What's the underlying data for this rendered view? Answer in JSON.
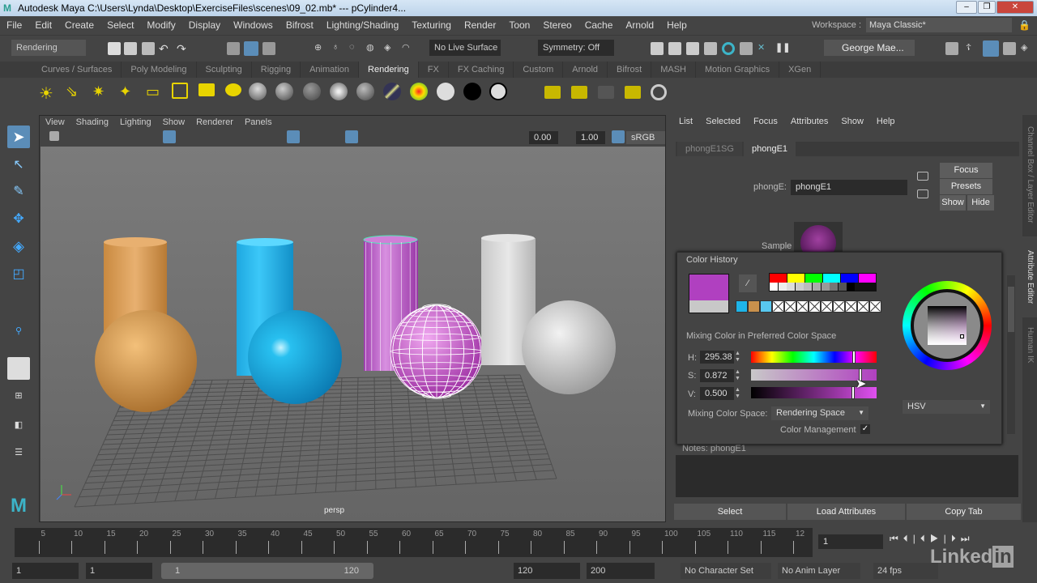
{
  "title": "Autodesk Maya  C:\\Users\\Lynda\\Desktop\\ExerciseFiles\\scenes\\09_02.mb*   ---   pCylinder4...",
  "menu": [
    "File",
    "Edit",
    "Create",
    "Select",
    "Modify",
    "Display",
    "Windows",
    "Bifrost",
    "Lighting/Shading",
    "Texturing",
    "Render",
    "Toon",
    "Stereo",
    "Cache",
    "Arnold",
    "Help"
  ],
  "workspace": {
    "label": "Workspace :",
    "value": "Maya Classic*"
  },
  "status": {
    "menuset": "Rendering",
    "live_surface": "No Live Surface",
    "symmetry": "Symmetry: Off",
    "user": "George Mae..."
  },
  "shelf_tabs": [
    "Curves / Surfaces",
    "Poly Modeling",
    "Sculpting",
    "Rigging",
    "Animation",
    "Rendering",
    "FX",
    "FX Caching",
    "Custom",
    "Arnold",
    "Bifrost",
    "MASH",
    "Motion Graphics",
    "XGen"
  ],
  "viewport": {
    "menu": [
      "View",
      "Shading",
      "Lighting",
      "Show",
      "Renderer",
      "Panels"
    ],
    "exposure": "0.00",
    "gamma": "1.00",
    "colorspace": "sRGB gam",
    "camera": "persp"
  },
  "ae": {
    "menu": [
      "List",
      "Selected",
      "Focus",
      "Attributes",
      "Show",
      "Help"
    ],
    "tabs": [
      "phongE1SG",
      "phongE1"
    ],
    "node_label": "phongE:",
    "node_value": "phongE1",
    "focus": "Focus",
    "presets": "Presets",
    "show": "Show",
    "hide": "Hide",
    "sample": "Sample",
    "notes": "Notes:  phongE1",
    "select": "Select",
    "load": "Load Attributes",
    "copy": "Copy Tab"
  },
  "side_tabs": [
    "Channel Box / Layer Editor",
    "Attribute Editor",
    "Human IK"
  ],
  "color_picker": {
    "history_label": "Color History",
    "mixing_label": "Mixing Color in Preferred Color Space",
    "h_label": "H:",
    "h": "295.38",
    "s_label": "S:",
    "s": "0.872",
    "v_label": "V:",
    "v": "0.500",
    "space_label": "Mixing Color Space:",
    "space": "Rendering Space",
    "mgmt": "Color Management",
    "mode": "HSV",
    "current_color": "#b040c0",
    "previous_color": "#c8c8c8",
    "h_fraction": 0.82,
    "s_fraction": 0.872,
    "v_fraction": 0.5
  },
  "timeline": {
    "ticks": [
      "5",
      "10",
      "15",
      "20",
      "25",
      "30",
      "35",
      "40",
      "45",
      "50",
      "55",
      "60",
      "65",
      "70",
      "75",
      "80",
      "85",
      "90",
      "95",
      "100",
      "105",
      "110",
      "115",
      "12"
    ],
    "start_label": "1",
    "current": "1"
  },
  "range": {
    "start": "1",
    "anim_start": "1",
    "slider_start": "1",
    "slider_end": "120",
    "end": "120",
    "anim_end": "200",
    "char_set": "No Character Set",
    "anim_layer": "No Anim Layer",
    "fps": "24 fps"
  },
  "watermark": "Linkedin"
}
